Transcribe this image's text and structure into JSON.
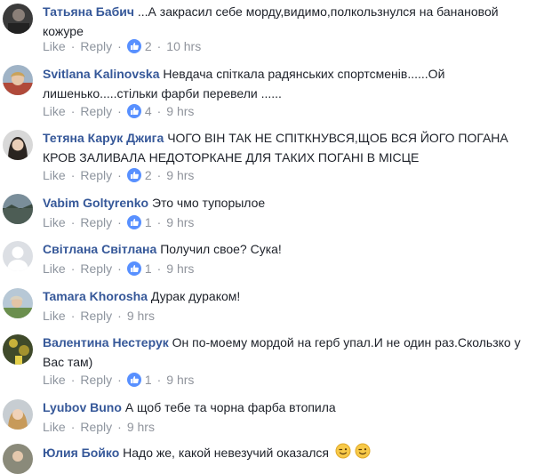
{
  "actions": {
    "like": "Like",
    "reply": "Reply",
    "sep": "·"
  },
  "comments": [
    {
      "author": "Татьяна Бабич",
      "text": "...А закрасил себе морду,видимо,полкользнулся на банановой кожуре",
      "likes": "2",
      "time": "10 hrs"
    },
    {
      "author": "Svitlana Kalinovska",
      "text": "Невдача спіткала радянських спортсменів......Ой лишенько.....стільки фарби перевели ......",
      "likes": "4",
      "time": "9 hrs"
    },
    {
      "author": "Тетяна Карук Джига",
      "text": "ЧОГО ВІН ТАК НЕ СПІТКНУВСЯ,ЩОБ ВСЯ ЙОГО ПОГАНА КРОВ ЗАЛИВАЛА НЕДОТОРКАНЕ ДЛЯ ТАКИХ ПОГАНІ В МІСЦЕ",
      "likes": "2",
      "time": "9 hrs"
    },
    {
      "author": "Vabim Goltyrenko",
      "text": "Это чмо тупорылое",
      "likes": "1",
      "time": "9 hrs"
    },
    {
      "author": "Світлана Світлана",
      "text": "Получил свое? Сука!",
      "likes": "1",
      "time": "9 hrs"
    },
    {
      "author": "Tamara Khorosha",
      "text": "Дурак дураком!",
      "likes": "",
      "time": "9 hrs"
    },
    {
      "author": "Валентина Нестерук",
      "text": "Он по-моему мордой на герб упал.И не один раз.Скользко у Вас там)",
      "likes": "1",
      "time": "9 hrs"
    },
    {
      "author": "Lyubov Buno",
      "text": "А щоб тебе та чорна фарба втопила",
      "likes": "",
      "time": "9 hrs"
    },
    {
      "author": "Юлия Бойко",
      "text": "Надо же, какой невезучий оказался",
      "likes": "",
      "time": ""
    }
  ],
  "colors": {
    "author": "#365899",
    "meta": "#90949c",
    "like_icon": "#5890ff"
  }
}
